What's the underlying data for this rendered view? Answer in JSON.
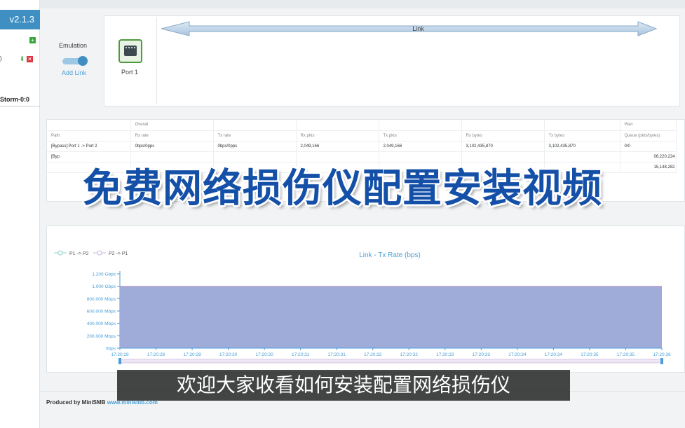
{
  "sidebar": {
    "version": "v2.1.3",
    "paren": ")",
    "storm_label": "Storm-0:0",
    "icons": {
      "add": "plus-icon",
      "download": "download-icon",
      "delete": "delete-icon"
    },
    "accent": "#3f8fc3"
  },
  "emulation": {
    "label": "Emulation",
    "add_link": "Add Link",
    "toggle_on": true
  },
  "port": {
    "label": "Port 1",
    "icon": "ethernet-port-icon"
  },
  "link": {
    "label": "Link"
  },
  "stats": {
    "group_headers": [
      "Overall",
      "Wan"
    ],
    "columns": [
      "Path",
      "Rx rate",
      "Tx rate",
      "Rx pkts",
      "Tx pkts",
      "Rx bytes",
      "Tx bytes",
      "Queue (pkts/bytes)"
    ],
    "rows": [
      [
        "[Bypass]:Port 1 -> Port 2",
        "0bps/0pps",
        "0bps/0pps",
        "2,049,166",
        "2,049,166",
        "3,102,435,870",
        "3,102,435,870",
        "0/0"
      ],
      [
        "[Byp",
        "",
        "",
        "",
        "",
        "",
        "",
        ""
      ]
    ],
    "overflow_values": [
      "06,220,224",
      "15,148,282"
    ]
  },
  "overlay_title": "免费网络损伤仪配置安装视频",
  "chart_data": {
    "type": "area",
    "title": "Link - Tx Rate (bps)",
    "legend": [
      {
        "name": "P1 -> P2",
        "color": "#8fd3c8"
      },
      {
        "name": "P2 -> P1",
        "color": "#c8b6e2"
      }
    ],
    "legend_position": "top-left",
    "y_ticks": [
      "1.200 Gbps",
      "1.000 Gbps",
      "800.000 Mbps",
      "600.000 Mbps",
      "400.000 Mbps",
      "200.000 Mbps",
      "0bps"
    ],
    "ylim": [
      0,
      1.2
    ],
    "y_unit": "Gbps",
    "x": [
      "17:20:28",
      "17:20:28",
      "17:20:28",
      "17:20:30",
      "17:20:30",
      "17:20:31",
      "17:20:31",
      "17:20:32",
      "17:20:32",
      "17:20:33",
      "17:20:33",
      "17:20:34",
      "17:20:34",
      "17:20:35",
      "17:20:35",
      "17:20:36"
    ],
    "series": [
      {
        "name": "P1 -> P2",
        "values": [
          1.0,
          1.0,
          1.0,
          1.0,
          1.0,
          1.0,
          1.0,
          1.0,
          1.0,
          1.0,
          1.0,
          1.0,
          1.0,
          1.0,
          1.0,
          1.0
        ]
      },
      {
        "name": "P2 -> P1",
        "values": [
          0,
          0,
          0,
          0,
          0,
          0,
          0,
          0,
          0,
          0,
          0,
          0,
          0,
          0,
          0,
          0
        ]
      }
    ],
    "fill_color": "#9aa8d8",
    "axis_color": "#4a9fd8",
    "grid": false
  },
  "subtitle": "欢迎大家收看如何安装配置网络损伤仪",
  "footer": {
    "produced_by": "Produced by MiniSMB",
    "url": "www.minismb.com"
  }
}
